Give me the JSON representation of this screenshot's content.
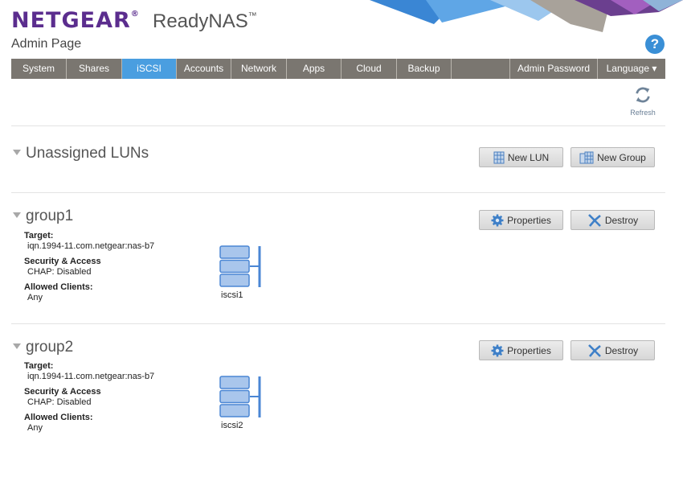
{
  "header": {
    "brand": "NETGEAR",
    "brand_mark": "®",
    "product": "ReadyNAS",
    "product_mark": "™",
    "page_title": "Admin Page",
    "help": "?"
  },
  "nav": {
    "items": [
      "System",
      "Shares",
      "iSCSI",
      "Accounts",
      "Network",
      "Apps",
      "Cloud",
      "Backup",
      "",
      "Admin Password",
      "Language ▾"
    ],
    "active": "iSCSI"
  },
  "toolbar": {
    "refresh_label": "Refresh"
  },
  "unassigned": {
    "title": "Unassigned LUNs",
    "new_lun": "New LUN",
    "new_group": "New Group"
  },
  "labels": {
    "target": "Target:",
    "security": "Security & Access",
    "clients": "Allowed Clients:",
    "properties": "Properties",
    "destroy": "Destroy"
  },
  "groups": [
    {
      "name": "group1",
      "target": "iqn.1994-11.com.netgear:nas-b7",
      "security": "CHAP: Disabled",
      "clients": "Any",
      "lun": "iscsi1"
    },
    {
      "name": "group2",
      "target": "iqn.1994-11.com.netgear:nas-b7",
      "security": "CHAP: Disabled",
      "clients": "Any",
      "lun": "iscsi2"
    }
  ],
  "colors": {
    "brand": "#5b2d8e",
    "nav": "#7a7670",
    "nav_active": "#4a9ee0",
    "accent": "#3a8fd6"
  }
}
